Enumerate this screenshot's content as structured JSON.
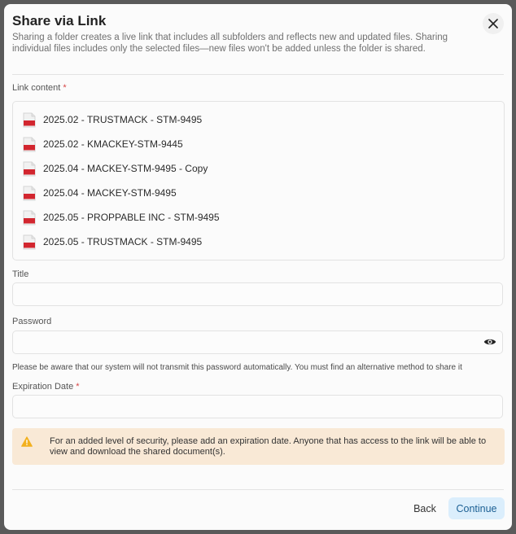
{
  "dialog": {
    "title": "Share via Link",
    "subtitle": "Sharing a folder creates a live link that includes all subfolders and reflects new and updated files. Sharing individual files includes only the selected files—new files won't be added unless the folder is shared."
  },
  "link_content": {
    "label": "Link content",
    "required_mark": "*",
    "files": [
      {
        "name": "2025.02 - TRUSTMACK - STM-9495",
        "icon": "pdf-file-icon"
      },
      {
        "name": "2025.02 - KMACKEY-STM-9445",
        "icon": "pdf-file-icon"
      },
      {
        "name": "2025.04 - MACKEY-STM-9495 - Copy",
        "icon": "pdf-file-icon"
      },
      {
        "name": "2025.04 - MACKEY-STM-9495",
        "icon": "pdf-file-icon"
      },
      {
        "name": "2025.05 - PROPPABLE INC - STM-9495",
        "icon": "pdf-file-icon"
      },
      {
        "name": "2025.05 - TRUSTMACK - STM-9495",
        "icon": "pdf-file-icon"
      }
    ]
  },
  "title_field": {
    "label": "Title",
    "value": ""
  },
  "password_field": {
    "label": "Password",
    "value": "",
    "note": "Please be aware that our system will not transmit this password automatically. You must find an alternative method to share it"
  },
  "expiration_field": {
    "label": "Expiration Date",
    "required_mark": "*",
    "value": ""
  },
  "warning": {
    "text": "For an added level of security, please add an expiration date. Anyone that has access to the link will be able to view and download the shared document(s)."
  },
  "footer": {
    "back_label": "Back",
    "continue_label": "Continue"
  },
  "colors": {
    "accent_bg": "#dbeefc",
    "accent_text": "#1b5f93",
    "warning_bg": "#f9e9d6",
    "required": "#d64545"
  }
}
